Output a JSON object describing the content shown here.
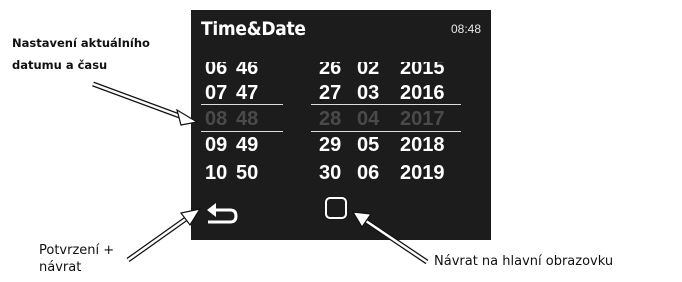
{
  "annotations": {
    "top_left": "Nastavení aktuálního datumu a času",
    "bottom_left": "Potvrzení + návrat",
    "bottom_right": "Návrat na hlavní obrazovku"
  },
  "device": {
    "title": "Time&Date",
    "time": "08:48",
    "picker": {
      "rows": [
        {
          "hour": "06",
          "minute": "46",
          "day": "26",
          "month": "02",
          "year": "2015"
        },
        {
          "hour": "07",
          "minute": "47",
          "day": "27",
          "month": "03",
          "year": "2016"
        },
        {
          "hour": "08",
          "minute": "48",
          "day": "28",
          "month": "04",
          "year": "2017"
        },
        {
          "hour": "09",
          "minute": "49",
          "day": "29",
          "month": "05",
          "year": "2018"
        },
        {
          "hour": "10",
          "minute": "50",
          "day": "30",
          "month": "06",
          "year": "2019"
        }
      ],
      "selected_index": 2
    },
    "nav": {
      "back_icon": "back-arrow-icon",
      "home_icon": "square-home-icon"
    }
  },
  "colors": {
    "screen_background": "#1c1c1c",
    "text": "#ffffff",
    "selected_row_text": "#4a4a4a",
    "annotation_text": "#111111"
  }
}
